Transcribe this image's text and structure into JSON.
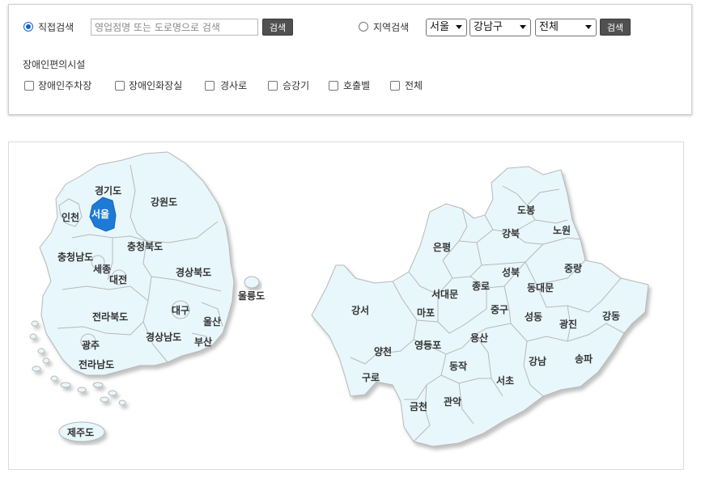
{
  "search": {
    "direct": {
      "label": "직접검색",
      "selected": true,
      "placeholder": "영업점명 또는 도로명으로 검색",
      "value": "",
      "button": "검색"
    },
    "region": {
      "label": "지역검색",
      "selected": false,
      "city": "서울",
      "district": "강남구",
      "type": "전체",
      "button": "검색"
    }
  },
  "facilities": {
    "title": "장애인편의시설",
    "options": [
      {
        "label": "장애인주차장",
        "checked": false
      },
      {
        "label": "장애인화장실",
        "checked": false
      },
      {
        "label": "경사로",
        "checked": false
      },
      {
        "label": "승강기",
        "checked": false
      },
      {
        "label": "호출벨",
        "checked": false
      },
      {
        "label": "전체",
        "checked": false
      }
    ]
  },
  "map_korea": {
    "selected": "서울",
    "regions": [
      "경기도",
      "강원도",
      "인천",
      "서울",
      "충청북도",
      "충청남도",
      "세종",
      "대전",
      "경상북도",
      "울릉도",
      "대구",
      "울산",
      "전라북도",
      "경상남도",
      "부산",
      "광주",
      "전라남도",
      "제주도"
    ]
  },
  "map_seoul": {
    "districts": [
      "도봉",
      "노원",
      "강북",
      "은평",
      "성북",
      "중랑",
      "종로",
      "서대문",
      "동대문",
      "마포",
      "중구",
      "강서",
      "성동",
      "광진",
      "강동",
      "용산",
      "양천",
      "영등포",
      "동작",
      "강남",
      "송파",
      "구로",
      "서초",
      "금천",
      "관악"
    ]
  },
  "colors": {
    "region_fill": "#e8f7fc",
    "region_stroke": "#b8b8b8",
    "selected_fill": "#1d7bd6",
    "button_bg": "#505050"
  }
}
